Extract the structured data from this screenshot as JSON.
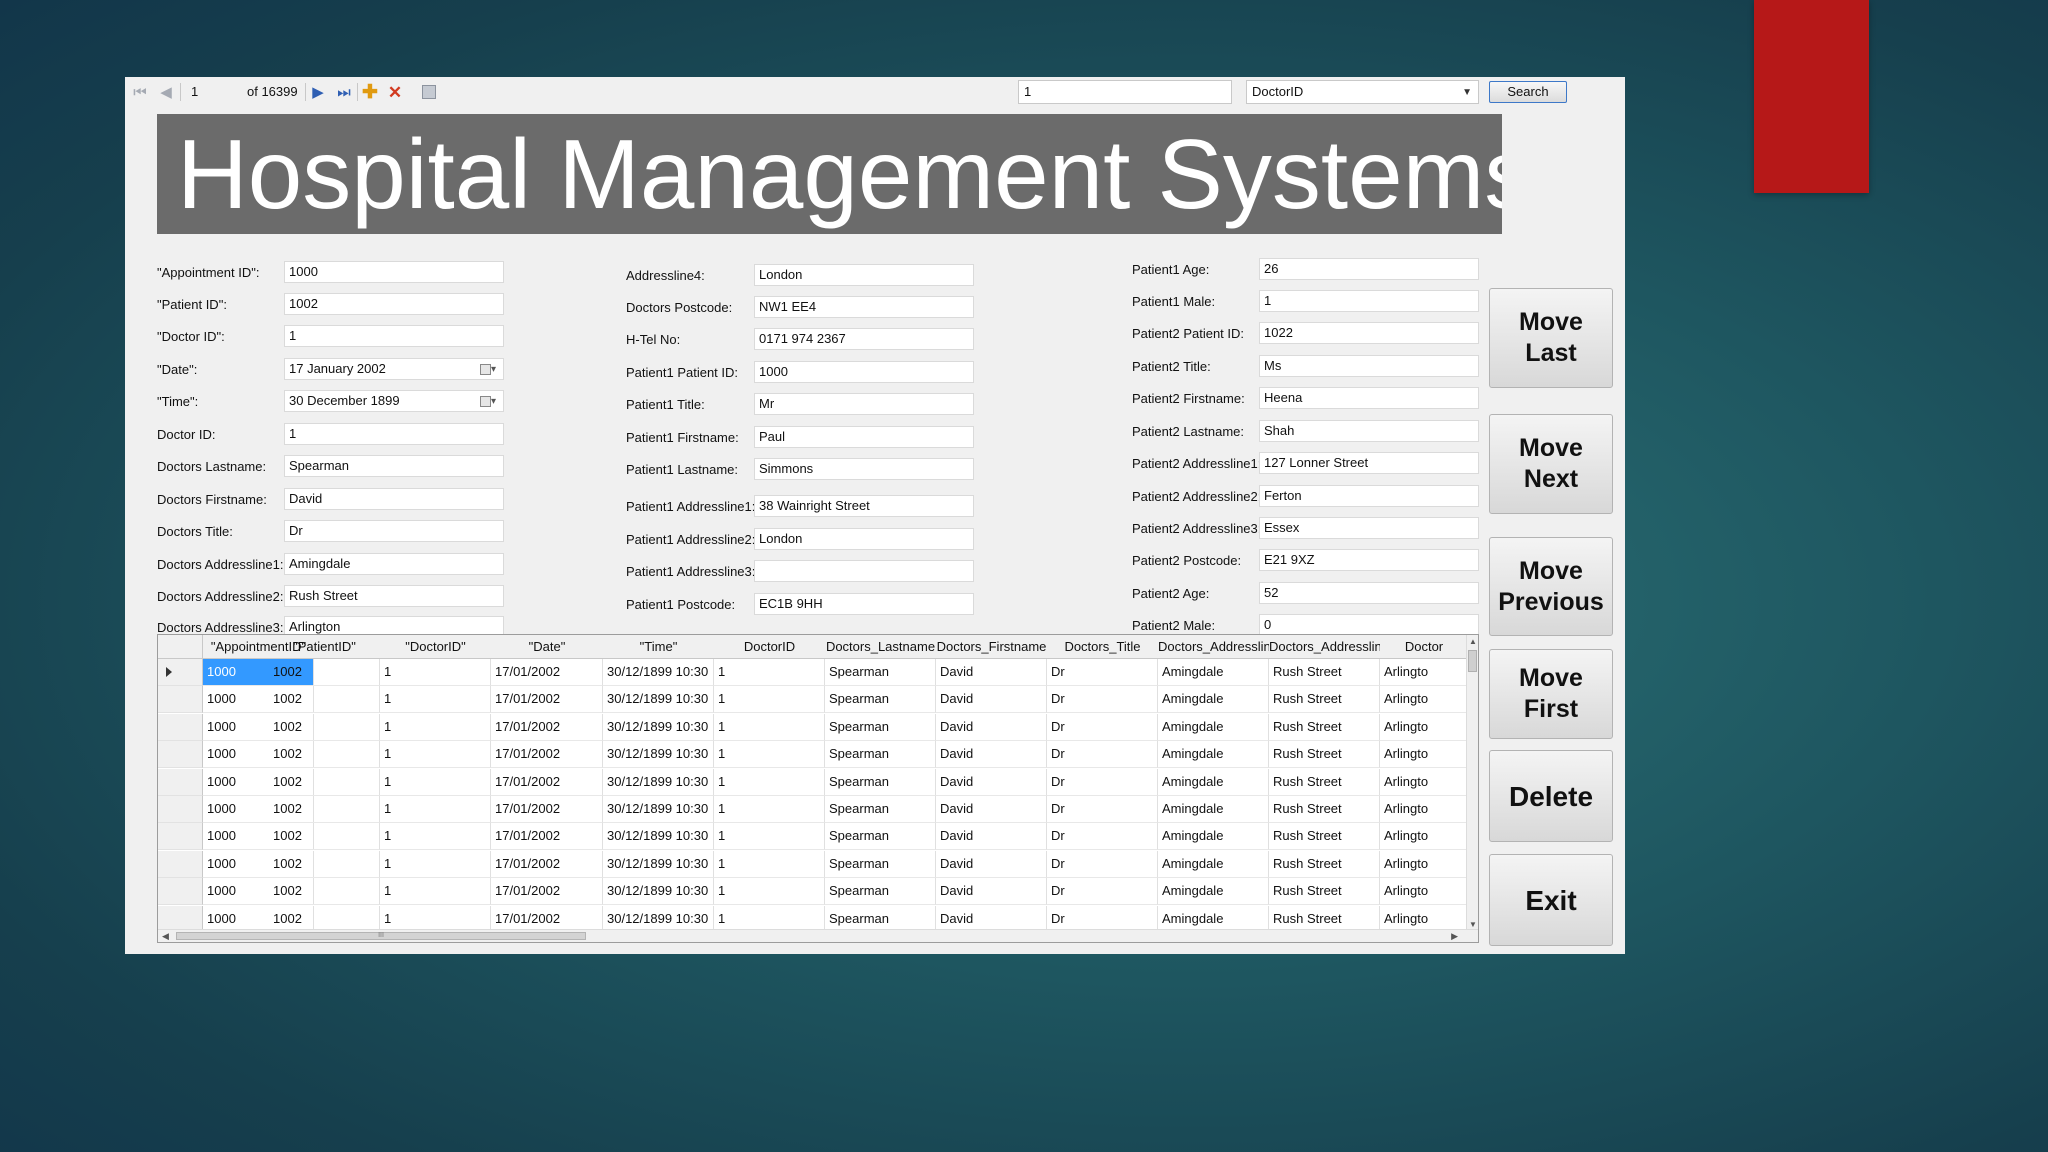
{
  "toolbar": {
    "position": "1",
    "of_total": "of 16399",
    "search_value": "1",
    "search_field": "DoctorID",
    "search_label": "Search"
  },
  "banner": {
    "title": "Hospital Management Systems"
  },
  "form": {
    "col1": [
      {
        "label": "\"Appointment ID\":",
        "value": "1000"
      },
      {
        "label": "\"Patient ID\":",
        "value": "1002"
      },
      {
        "label": "\"Doctor ID\":",
        "value": "1"
      },
      {
        "label": "\"Date\":",
        "value": "17   January   2002"
      },
      {
        "label": "\"Time\":",
        "value": "30 December 1899"
      },
      {
        "label": "Doctor ID:",
        "value": "1"
      },
      {
        "label": "Doctors Lastname:",
        "value": "Spearman"
      },
      {
        "label": "Doctors Firstname:",
        "value": "David"
      },
      {
        "label": "Doctors Title:",
        "value": "Dr"
      },
      {
        "label": "Doctors Addressline1:",
        "value": "Amingdale"
      },
      {
        "label": "Doctors Addressline2:",
        "value": "Rush Street"
      },
      {
        "label": "Doctors Addressline3:",
        "value": "Arlington"
      }
    ],
    "col2": [
      {
        "label": "Addressline4:",
        "value": "London"
      },
      {
        "label": "Doctors Postcode:",
        "value": "NW1 EE4"
      },
      {
        "label": "H-Tel No:",
        "value": "0171 974 2367"
      },
      {
        "label": "Patient1 Patient ID:",
        "value": "1000"
      },
      {
        "label": "Patient1 Title:",
        "value": "Mr"
      },
      {
        "label": "Patient1 Firstname:",
        "value": "Paul"
      },
      {
        "label": "Patient1 Lastname:",
        "value": "Simmons"
      },
      {
        "label": "Patient1 Addressline1:",
        "value": "38 Wainright Street"
      },
      {
        "label": "Patient1 Addressline2:",
        "value": "London"
      },
      {
        "label": "Patient1 Addressline3:",
        "value": ""
      },
      {
        "label": "Patient1 Postcode:",
        "value": "EC1B 9HH"
      }
    ],
    "col3": [
      {
        "label": "Patient1 Age:",
        "value": "26"
      },
      {
        "label": "Patient1 Male:",
        "value": "1"
      },
      {
        "label": "Patient2 Patient ID:",
        "value": "1022"
      },
      {
        "label": "Patient2 Title:",
        "value": "Ms"
      },
      {
        "label": "Patient2 Firstname:",
        "value": "Heena"
      },
      {
        "label": "Patient2 Lastname:",
        "value": "Shah"
      },
      {
        "label": "Patient2 Addressline1:",
        "value": "127 Lonner Street"
      },
      {
        "label": "Patient2 Addressline2:",
        "value": "Ferton"
      },
      {
        "label": "Patient2 Addressline3:",
        "value": "Essex"
      },
      {
        "label": "Patient2 Postcode:",
        "value": "E21 9XZ"
      },
      {
        "label": "Patient2 Age:",
        "value": "52"
      },
      {
        "label": "Patient2 Male:",
        "value": "0"
      }
    ]
  },
  "buttons": {
    "move_last": "Move\nLast",
    "move_next": "Move\nNext",
    "move_previous": "Move\nPrevious",
    "move_first": "Move\nFirst",
    "delete": "Delete",
    "exit": "Exit"
  },
  "grid": {
    "columns": [
      "\"AppointmentID\"",
      "\"PatientID\"",
      "\"DoctorID\"",
      "\"Date\"",
      "\"Time\"",
      "DoctorID",
      "Doctors_Lastname",
      "Doctors_Firstname",
      "Doctors_Title",
      "Doctors_Addresslin",
      "Doctors_Addresslin",
      "Doctor"
    ],
    "rows": [
      [
        "1000",
        "1002",
        "1",
        "17/01/2002",
        "30/12/1899 10:30",
        "1",
        "Spearman",
        "David",
        "Dr",
        "Amingdale",
        "Rush Street",
        "Arlingto"
      ],
      [
        "1000",
        "1002",
        "1",
        "17/01/2002",
        "30/12/1899 10:30",
        "1",
        "Spearman",
        "David",
        "Dr",
        "Amingdale",
        "Rush Street",
        "Arlingto"
      ],
      [
        "1000",
        "1002",
        "1",
        "17/01/2002",
        "30/12/1899 10:30",
        "1",
        "Spearman",
        "David",
        "Dr",
        "Amingdale",
        "Rush Street",
        "Arlingto"
      ],
      [
        "1000",
        "1002",
        "1",
        "17/01/2002",
        "30/12/1899 10:30",
        "1",
        "Spearman",
        "David",
        "Dr",
        "Amingdale",
        "Rush Street",
        "Arlingto"
      ],
      [
        "1000",
        "1002",
        "1",
        "17/01/2002",
        "30/12/1899 10:30",
        "1",
        "Spearman",
        "David",
        "Dr",
        "Amingdale",
        "Rush Street",
        "Arlingto"
      ],
      [
        "1000",
        "1002",
        "1",
        "17/01/2002",
        "30/12/1899 10:30",
        "1",
        "Spearman",
        "David",
        "Dr",
        "Amingdale",
        "Rush Street",
        "Arlingto"
      ],
      [
        "1000",
        "1002",
        "1",
        "17/01/2002",
        "30/12/1899 10:30",
        "1",
        "Spearman",
        "David",
        "Dr",
        "Amingdale",
        "Rush Street",
        "Arlingto"
      ],
      [
        "1000",
        "1002",
        "1",
        "17/01/2002",
        "30/12/1899 10:30",
        "1",
        "Spearman",
        "David",
        "Dr",
        "Amingdale",
        "Rush Street",
        "Arlingto"
      ],
      [
        "1000",
        "1002",
        "1",
        "17/01/2002",
        "30/12/1899 10:30",
        "1",
        "Spearman",
        "David",
        "Dr",
        "Amingdale",
        "Rush Street",
        "Arlingto"
      ],
      [
        "1000",
        "1002",
        "1",
        "17/01/2002",
        "30/12/1899 10:30",
        "1",
        "Spearman",
        "David",
        "Dr",
        "Amingdale",
        "Rush Street",
        "Arlingto"
      ]
    ],
    "selected_row": 0,
    "selected_col": 0,
    "selection_color": "#3399ff",
    "hscroll_grip": "III"
  },
  "icons": {
    "first_record": "first-record-icon",
    "previous_record": "previous-record-icon",
    "next_record": "next-record-icon",
    "last_record": "last-record-icon",
    "add_new": "add-new-icon",
    "delete_record": "delete-record-icon",
    "save": "save-icon"
  },
  "colors": {
    "banner_bg": "#6b6b6b",
    "accent_red": "#b61818",
    "search_border": "#3d78c8"
  }
}
